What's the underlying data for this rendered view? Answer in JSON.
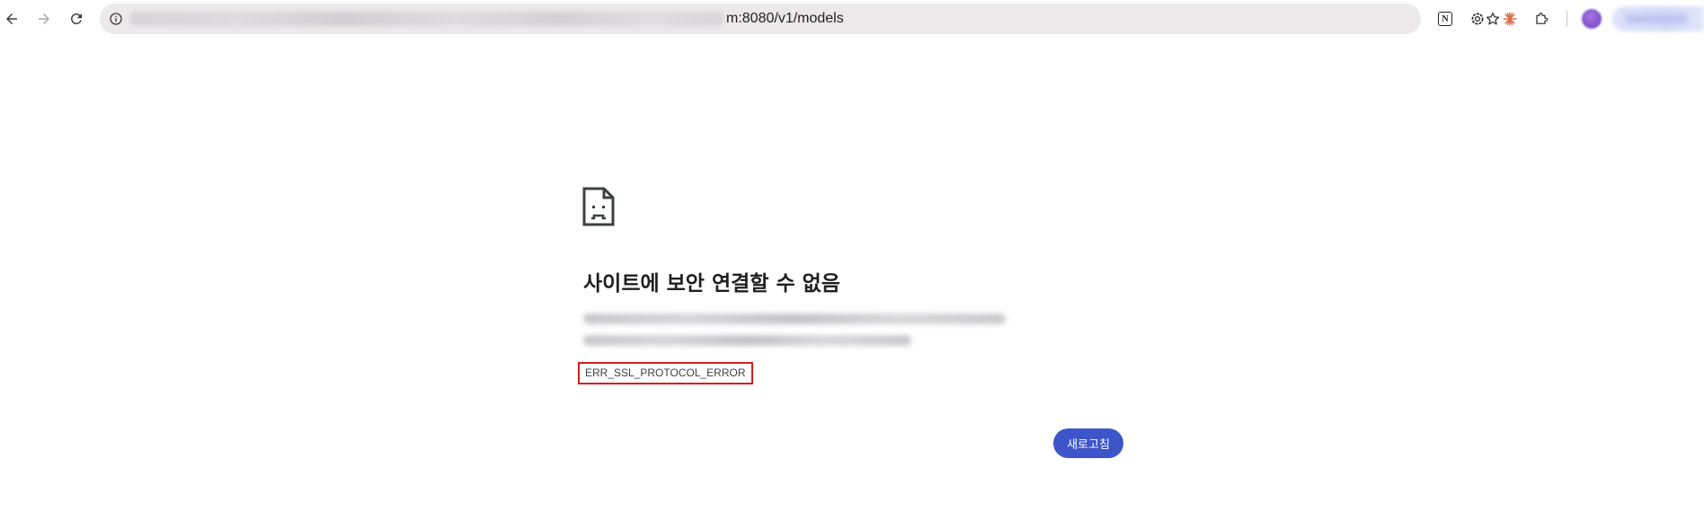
{
  "toolbar": {
    "address_bar": {
      "url_visible_suffix": "m:8080/v1/models"
    }
  },
  "error_page": {
    "title": "사이트에 보안 연결할 수 없음",
    "error_code": "ERR_SSL_PROTOCOL_ERROR",
    "reload_label": "새로고침"
  },
  "colors": {
    "accent": "#3c55c8",
    "highlight_box": "#d41f1f",
    "omnibox_bg": "#ebe9ea"
  }
}
